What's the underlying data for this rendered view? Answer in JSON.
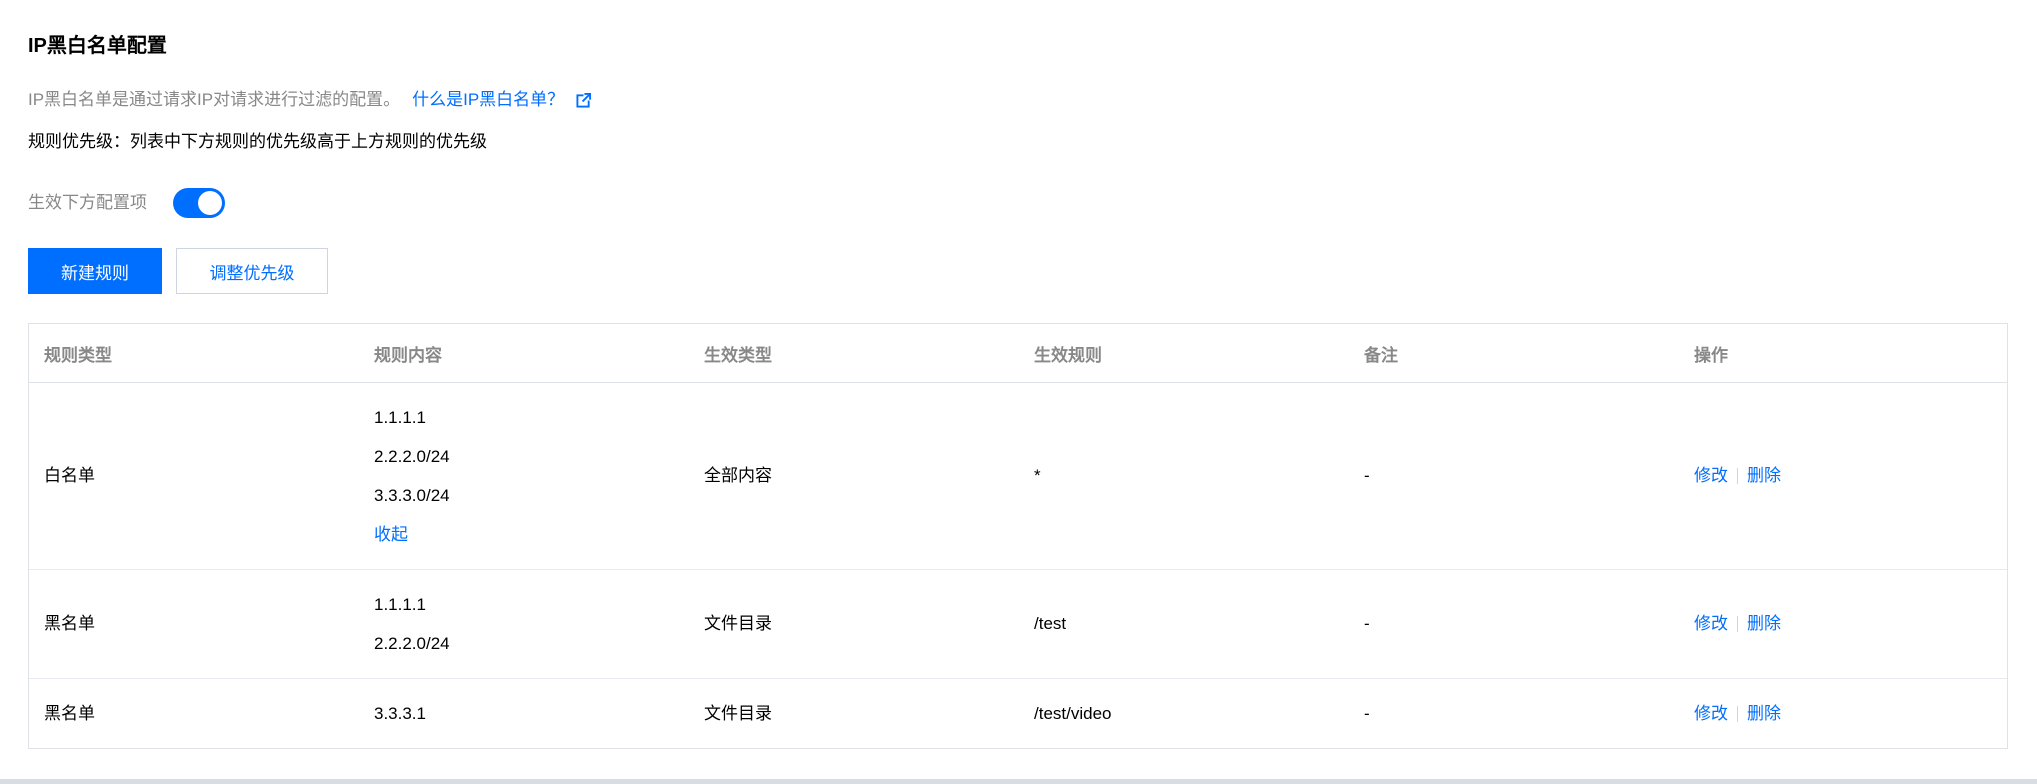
{
  "section": {
    "title": "IP黑白名单配置",
    "description": "IP黑白名单是通过请求IP对请求进行过滤的配置。",
    "help_link": "什么是IP黑白名单？",
    "priority_note": "规则优先级：列表中下方规则的优先级高于上方规则的优先级"
  },
  "toggle": {
    "label": "生效下方配置项",
    "enabled": true,
    "accent": "#006eff"
  },
  "toolbar": {
    "new_rule_label": "新建规则",
    "adjust_priority_label": "调整优先级"
  },
  "table": {
    "columns": [
      "规则类型",
      "规则内容",
      "生效类型",
      "生效规则",
      "备注",
      "操作"
    ],
    "rows": [
      {
        "type": "白名单",
        "ips": [
          "1.1.1.1",
          "2.2.2.0/24",
          "3.3.3.0/24"
        ],
        "collapse_label": "收起",
        "effect_type": "全部内容",
        "effect_rule": "*",
        "remark": "-",
        "edit_label": "修改",
        "delete_label": "删除"
      },
      {
        "type": "黑名单",
        "ips": [
          "1.1.1.1",
          "2.2.2.0/24"
        ],
        "effect_type": "文件目录",
        "effect_rule": "/test",
        "remark": "-",
        "edit_label": "修改",
        "delete_label": "删除"
      },
      {
        "type": "黑名单",
        "ips": [
          "3.3.3.1"
        ],
        "effect_type": "文件目录",
        "effect_rule": "/test/video",
        "remark": "-",
        "edit_label": "修改",
        "delete_label": "删除"
      }
    ]
  },
  "icons": {
    "external_link": "external-link-icon"
  }
}
